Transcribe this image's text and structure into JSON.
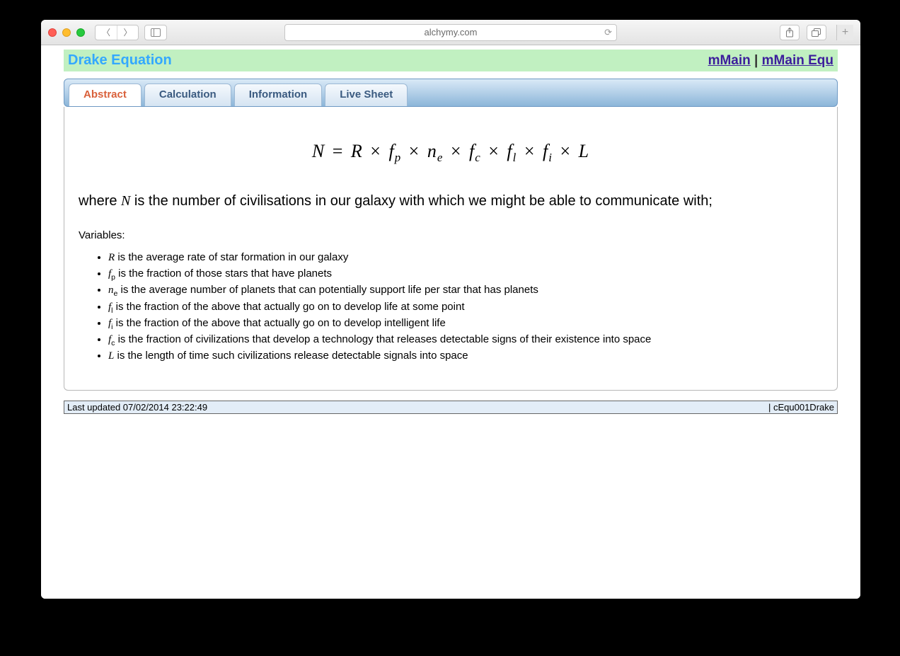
{
  "browser": {
    "url": "alchymy.com"
  },
  "header": {
    "title": "Drake Equation",
    "link1": "mMain",
    "sep": " | ",
    "link2": "mMain Equ"
  },
  "tabs": [
    {
      "label": "Abstract",
      "active": true
    },
    {
      "label": "Calculation",
      "active": false
    },
    {
      "label": "Information",
      "active": false
    },
    {
      "label": "Live Sheet",
      "active": false
    }
  ],
  "content": {
    "equation_parts": {
      "N": "N",
      "eq": " = ",
      "R": "R",
      "x": " × ",
      "fp": "f",
      "fp_sub": "p",
      "ne": "n",
      "ne_sub": "e",
      "fc": "f",
      "fc_sub": "c",
      "fl": "f",
      "fl_sub": "l",
      "fi": "f",
      "fi_sub": "i",
      "L": "L"
    },
    "where_pre": "where ",
    "where_sym": "N",
    "where_post": " is the number of civilisations in our galaxy with which we might be able to communicate with;",
    "variables_label": "Variables:",
    "variables": [
      {
        "sym": "R",
        "sub": "",
        "desc": " is the average rate of star formation in our galaxy"
      },
      {
        "sym": "f",
        "sub": "p",
        "desc": " is the fraction of those stars that have planets"
      },
      {
        "sym": "n",
        "sub": "e",
        "desc": " is the average number of planets that can potentially support life per star that has planets"
      },
      {
        "sym": "f",
        "sub": "l",
        "desc": " is the fraction of the above that actually go on to develop life at some point"
      },
      {
        "sym": "f",
        "sub": "i",
        "desc": " is the fraction of the above that actually go on to develop intelligent life"
      },
      {
        "sym": "f",
        "sub": "c",
        "desc": " is the fraction of civilizations that develop a technology that releases detectable signs of their existence into space"
      },
      {
        "sym": "L",
        "sub": "",
        "desc": " is the length of time such civilizations release detectable signals into space"
      }
    ]
  },
  "footer": {
    "left": "Last updated 07/02/2014 23:22:49",
    "right": "| cEqu001Drake"
  }
}
